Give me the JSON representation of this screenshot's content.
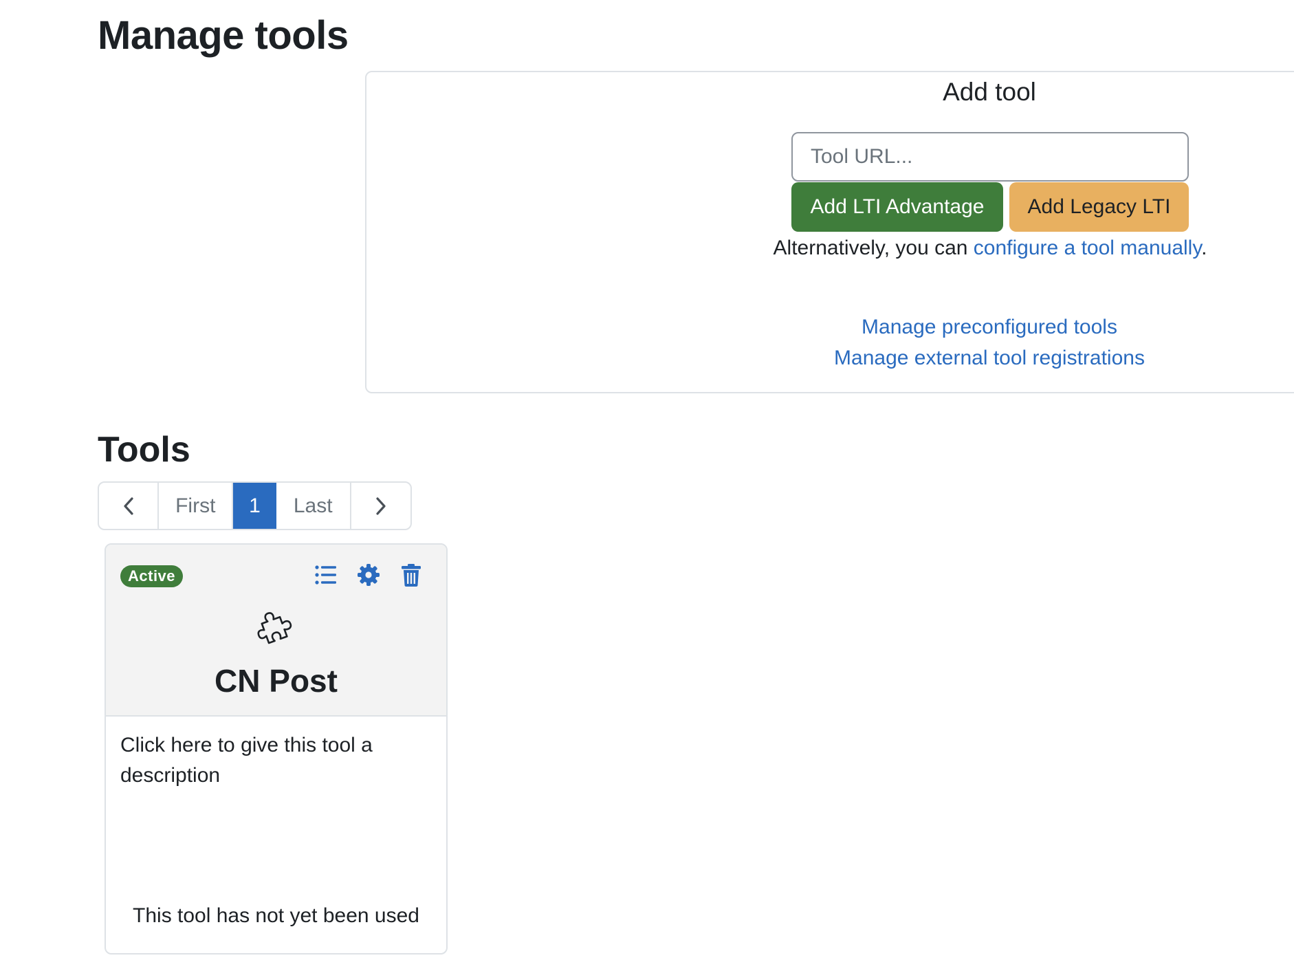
{
  "page": {
    "title": "Manage tools"
  },
  "add_tool": {
    "heading": "Add tool",
    "url_placeholder": "Tool URL...",
    "url_value": "",
    "add_lti_advantage_label": "Add LTI Advantage",
    "add_legacy_lti_label": "Add Legacy LTI",
    "alt_prefix": "Alternatively, you can ",
    "alt_link": "configure a tool manually",
    "alt_suffix": ".",
    "link_preconfigured": "Manage preconfigured tools",
    "link_registrations": "Manage external tool registrations"
  },
  "tools_section": {
    "heading": "Tools",
    "pagination": {
      "prev_icon": "chevron-left-icon",
      "first": "First",
      "current": "1",
      "last": "Last",
      "next_icon": "chevron-right-icon"
    },
    "cards": [
      {
        "status": "Active",
        "actions": [
          "list-icon",
          "gear-icon",
          "trash-icon"
        ],
        "icon": "puzzle-icon",
        "name": "CN Post",
        "description": "Click here to give this tool a description",
        "usage": "This tool has not yet been used"
      }
    ]
  },
  "colors": {
    "primary": "#2a6bbf",
    "success": "#3f7d3b",
    "warning": "#e8b060",
    "border": "#dee2e6",
    "card_header": "#f3f3f3",
    "text": "#1d2125"
  }
}
